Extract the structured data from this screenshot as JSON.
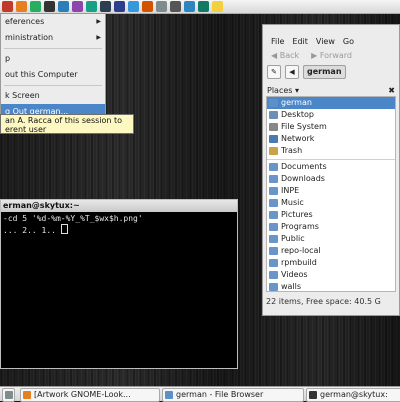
{
  "top_panel": {
    "launchers": [
      {
        "icon": "foot-menu-icon",
        "color": "#c0392b"
      },
      {
        "icon": "firefox-icon",
        "color": "#e67e22"
      },
      {
        "icon": "chrome-icon",
        "color": "#27ae60"
      },
      {
        "icon": "terminal-icon",
        "color": "#333333"
      },
      {
        "icon": "files-icon",
        "color": "#2980b9"
      },
      {
        "icon": "editor-icon",
        "color": "#8e44ad"
      },
      {
        "icon": "music-icon",
        "color": "#16a085"
      },
      {
        "icon": "app-icon",
        "color": "#2c3e50"
      },
      {
        "icon": "star-icon",
        "color": "#2c3e8c"
      },
      {
        "icon": "image-icon",
        "color": "#3498db"
      },
      {
        "icon": "palette-icon",
        "color": "#d35400"
      },
      {
        "icon": "draw-icon",
        "color": "#7f8c8d"
      },
      {
        "icon": "mail-icon",
        "color": "#555555"
      },
      {
        "icon": "chat-icon",
        "color": "#2e86c1"
      },
      {
        "icon": "dictionary-icon",
        "color": "#117a65"
      },
      {
        "icon": "weather-icon",
        "color": "#f4d03f"
      }
    ]
  },
  "system_menu": {
    "items": [
      {
        "label": "eferences",
        "has_submenu": true
      },
      {
        "label": "ministration",
        "has_submenu": true
      },
      {
        "label": "p",
        "has_submenu": false
      },
      {
        "label": "out this Computer",
        "has_submenu": false
      },
      {
        "label": "k Screen",
        "has_submenu": false
      },
      {
        "label": "g Out german...",
        "has_submenu": false,
        "active": true
      }
    ],
    "tooltip_line1": "an A. Racca of this session to",
    "tooltip_line2": "erent user"
  },
  "terminal": {
    "title": "erman@skytux:~",
    "line1": "-cd 5 '%d-%m-%Y_%T_$wx$h.png'",
    "line2": "... 2.. 1.. "
  },
  "browser": {
    "menu": [
      "File",
      "Edit",
      "View",
      "Go"
    ],
    "back_label": "Back",
    "forward_label": "Forward",
    "location": "german",
    "places_label": "Places",
    "places": [
      {
        "label": "german",
        "icon": "home-folder-icon",
        "color": "#5d8fc9",
        "selected": true
      },
      {
        "label": "Desktop",
        "icon": "desktop-icon",
        "color": "#6b8fb5"
      },
      {
        "label": "File System",
        "icon": "drive-icon",
        "color": "#888888"
      },
      {
        "label": "Network",
        "icon": "network-icon",
        "color": "#4a7ab0"
      },
      {
        "label": "Trash",
        "icon": "trash-icon",
        "color": "#c9a24a"
      },
      {
        "label": "Documents",
        "icon": "folder-icon",
        "color": "#6a95c8",
        "sep": true
      },
      {
        "label": "Downloads",
        "icon": "folder-icon",
        "color": "#6a95c8"
      },
      {
        "label": "INPE",
        "icon": "folder-icon",
        "color": "#6a95c8"
      },
      {
        "label": "Music",
        "icon": "folder-icon",
        "color": "#6a95c8"
      },
      {
        "label": "Pictures",
        "icon": "folder-icon",
        "color": "#6a95c8"
      },
      {
        "label": "Programs",
        "icon": "folder-icon",
        "color": "#6a95c8"
      },
      {
        "label": "Public",
        "icon": "folder-icon",
        "color": "#6a95c8"
      },
      {
        "label": "repo-local",
        "icon": "folder-icon",
        "color": "#6a95c8"
      },
      {
        "label": "rpmbuild",
        "icon": "folder-icon",
        "color": "#6a95c8"
      },
      {
        "label": "Videos",
        "icon": "folder-icon",
        "color": "#6a95c8"
      },
      {
        "label": "walls",
        "icon": "folder-icon",
        "color": "#6a95c8"
      }
    ],
    "status": "22 items, Free space: 40.5 G"
  },
  "taskbar": {
    "tasks": [
      {
        "label": "",
        "icon": "show-desktop-icon"
      },
      {
        "label": "[Artwork GNOME-Look...",
        "icon": "browser-icon"
      },
      {
        "label": "german - File Browser",
        "icon": "file-browser-icon"
      },
      {
        "label": "german@skytux:",
        "icon": "terminal-icon"
      }
    ]
  }
}
